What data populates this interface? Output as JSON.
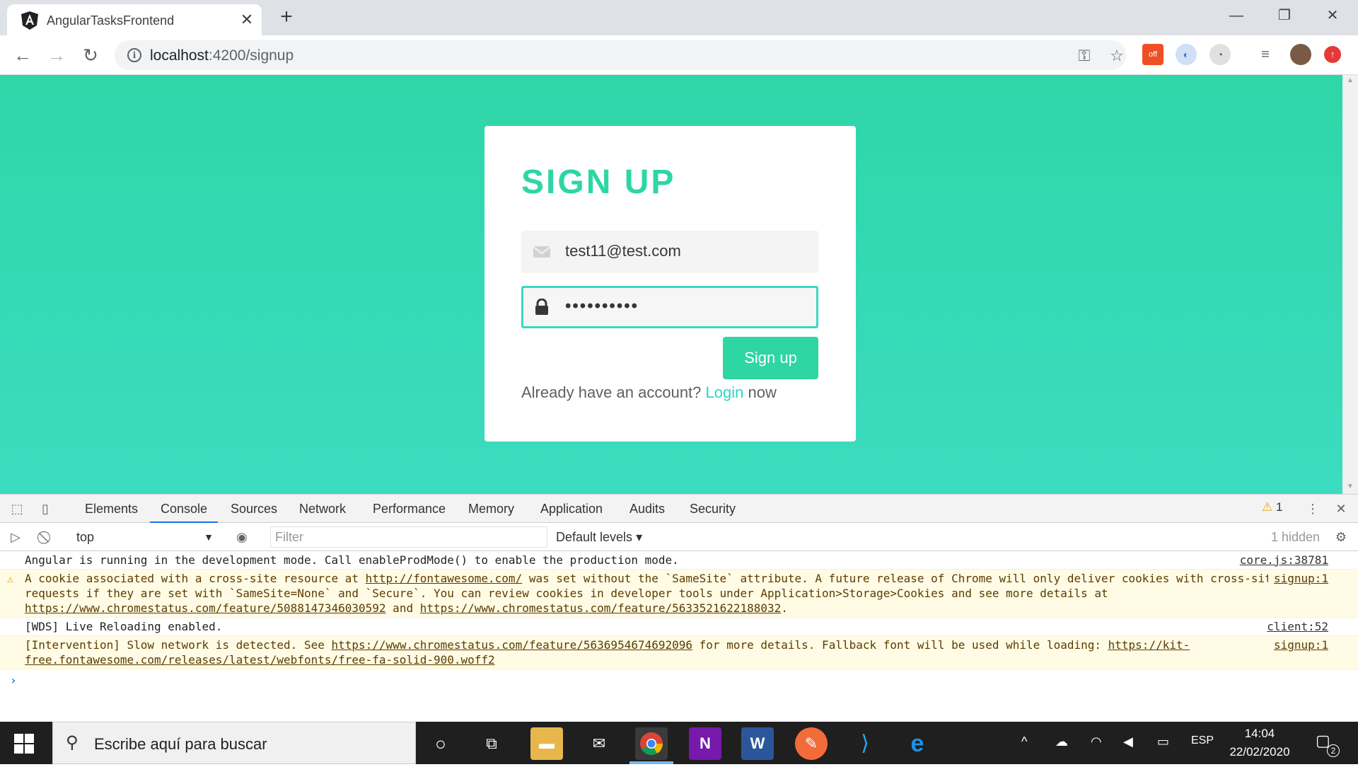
{
  "browser": {
    "tab_title": "AngularTasksFrontend",
    "tab_close": "✕",
    "new_tab": "+",
    "url_host": "localhost",
    "url_path": ":4200/signup",
    "window_controls": [
      "—",
      "❐",
      "✕"
    ]
  },
  "page": {
    "title": "SIGN UP",
    "email_value": "test11@test.com",
    "password_value": "••••••••••",
    "signup_button": "Sign up",
    "already_prefix": "Already have an account? ",
    "login_link": "Login",
    "already_suffix": " now"
  },
  "devtools": {
    "tabs": [
      "Elements",
      "Console",
      "Sources",
      "Network",
      "Performance",
      "Memory",
      "Application",
      "Audits",
      "Security"
    ],
    "active_tab": "Console",
    "warning_count": "1",
    "context": "top",
    "filter_placeholder": "Filter",
    "levels": "Default levels",
    "hidden": "1 hidden",
    "messages": [
      {
        "type": "info",
        "text": "Angular is running in the development mode. Call enableProdMode() to enable the production mode.",
        "source": "core.js:38781"
      },
      {
        "type": "warn",
        "parts": [
          "A cookie associated with a cross-site resource at ",
          "http://fontawesome.com/",
          " was set without the `SameSite` attribute. A future release of Chrome will only deliver cookies with cross-site requests if they are set with `SameSite=None` and `Secure`. You can review cookies in developer tools under Application>Storage>Cookies and see more details at ",
          "https://www.chromestatus.com/feature/5088147346030592",
          " and ",
          "https://www.chromestatus.com/feature/5633521622188032",
          "."
        ],
        "source": "signup:1"
      },
      {
        "type": "info",
        "text": "[WDS] Live Reloading enabled.",
        "source": "client:52"
      },
      {
        "type": "warn",
        "parts": [
          "[Intervention] Slow network is detected. See ",
          "https://www.chromestatus.com/feature/5636954674692096",
          " for more details. Fallback font will be used while loading: ",
          "https://kit-free.fontawesome.com/releases/latest/webfonts/free-fa-solid-900.woff2",
          ""
        ],
        "source": "signup:1"
      }
    ],
    "prompt": "›"
  },
  "taskbar": {
    "search_placeholder": "Escribe aquí para buscar",
    "language": "ESP",
    "time": "14:04",
    "date": "22/02/2020",
    "notification_count": "2"
  },
  "colors": {
    "accent": "#2ed6a4",
    "link": "#2ed6c4"
  }
}
